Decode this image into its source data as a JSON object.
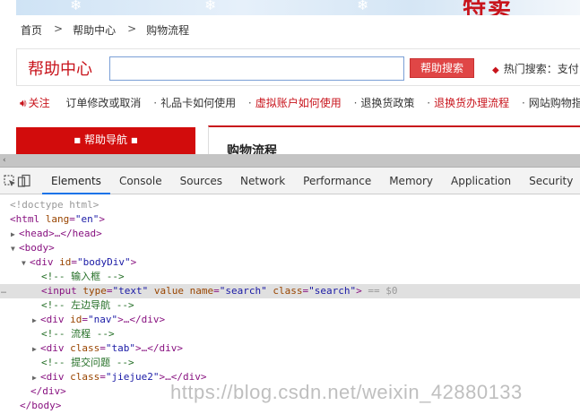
{
  "site": {
    "brand": "特卖",
    "breadcrumb": [
      "首页",
      "帮助中心",
      "购物流程"
    ],
    "breadcrumb_sep": ">",
    "help_title": "帮助中心",
    "search_value": "",
    "search_button": "帮助搜索",
    "hot_search_label": "热门搜索：",
    "hot_search_first": "支付",
    "follow_label": "关注",
    "quick_links": [
      {
        "label": "订单修改或取消",
        "red": false
      },
      {
        "label": "礼品卡如何使用",
        "red": false
      },
      {
        "label": "虚拟账户如何使用",
        "red": true
      },
      {
        "label": "退换货政策",
        "red": false
      },
      {
        "label": "退换货办理流程",
        "red": true
      },
      {
        "label": "网站购物指南",
        "red": false
      }
    ],
    "nav_header": "帮助导航",
    "flow_title": "购物流程"
  },
  "devtools": {
    "tabs": [
      "Elements",
      "Console",
      "Sources",
      "Network",
      "Performance",
      "Memory",
      "Application",
      "Security"
    ],
    "active_tab": "Elements",
    "tree": {
      "doctype": "<!doctype html>",
      "html_open": "<html",
      "html_lang_attr": "lang",
      "html_lang_val": "\"en\"",
      "html_close_bracket": ">",
      "head": "<head>…</head>",
      "body_open": "<body>",
      "div_bodydiv_open": "<div",
      "div_bodydiv_attr": "id",
      "div_bodydiv_val": "\"bodyDiv\"",
      "comment_input": "<!-- 输入框 -->",
      "input_tag": "<input",
      "input_attr_type": "type",
      "input_val_type": "\"text\"",
      "input_attr_value": "value",
      "input_attr_name": "name",
      "input_val_name": "\"search\"",
      "input_attr_class": "class",
      "input_val_class": "\"search\"",
      "input_end": ">",
      "selected_marker": "== $0",
      "comment_nav": "<!-- 左边导航 -->",
      "div_nav_open": "<div",
      "div_nav_attr": "id",
      "div_nav_val": "\"nav\"",
      "div_nav_rest": ">…</div>",
      "comment_flow": "<!-- 流程 -->",
      "div_tab_open": "<div",
      "div_tab_attr": "class",
      "div_tab_val": "\"tab\"",
      "div_tab_rest": ">…</div>",
      "comment_submit": "<!-- 提交问题 -->",
      "div_jiejue_open": "<div",
      "div_jiejue_attr": "class",
      "div_jiejue_val": "\"jiejue2\"",
      "div_jiejue_rest": ">…</div>",
      "div_close": "</div>",
      "body_close": "</body>"
    }
  },
  "watermark": "https://blog.csdn.net/weixin_42880133",
  "colors": {
    "brand_red": "#c8141c",
    "devtools_active_tab": "#1a73e8"
  }
}
